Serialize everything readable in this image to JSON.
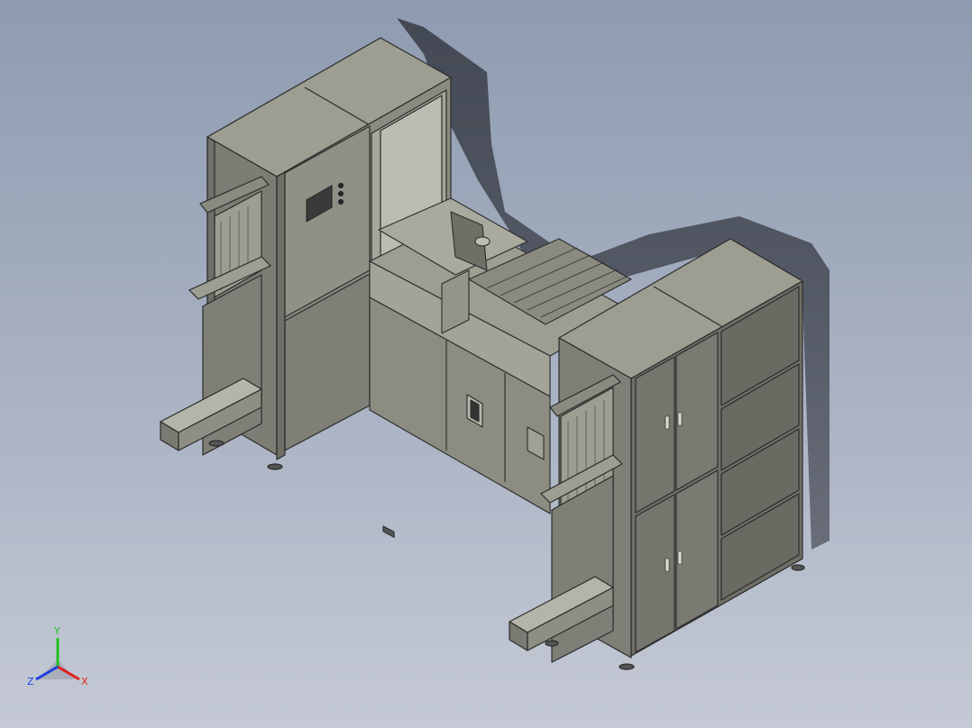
{
  "viewport": {
    "background_top": "#8e9bb0",
    "background_bottom": "#c4c9d4",
    "model_face_color": "#8c8c82",
    "model_top_color": "#9d9d92",
    "model_side_color": "#6f6f68",
    "edge_color": "#2b2b2b"
  },
  "triad": {
    "x_label": "X",
    "y_label": "Y",
    "z_label": "Z",
    "x_color": "#e02020",
    "y_color": "#20c020",
    "z_color": "#2040e0"
  }
}
